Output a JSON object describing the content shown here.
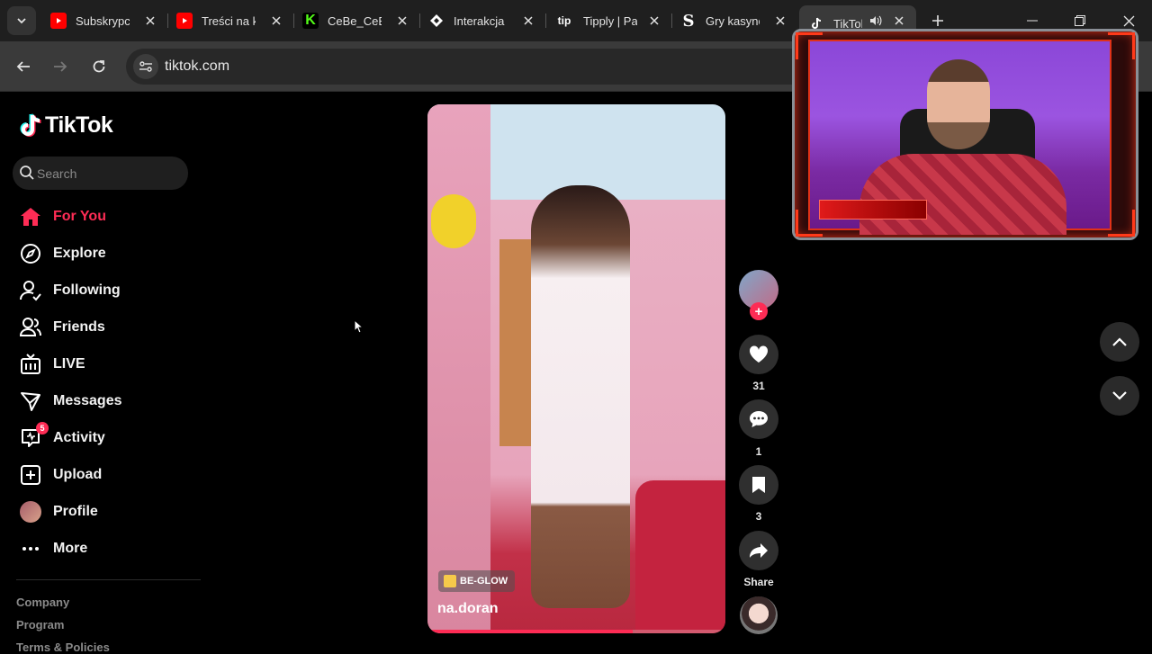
{
  "browser": {
    "tabs": [
      {
        "label": "Subskrypcje",
        "favicon": "youtube",
        "color": "#ff0000"
      },
      {
        "label": "Treści na kanale",
        "favicon": "youtube",
        "color": "#ff0000"
      },
      {
        "label": "CeBe_CeBe",
        "favicon": "kick",
        "color": "#53fc18"
      },
      {
        "label": "Interakcja",
        "favicon": "diamond",
        "color": "#ffffff"
      },
      {
        "label": "Tipply | Panel",
        "favicon": "tip",
        "color": "#ffffff"
      },
      {
        "label": "Gry kasynowe",
        "favicon": "s-logo",
        "color": "#ffffff"
      },
      {
        "label": "TikTok",
        "favicon": "tiktok",
        "color": "#ffffff"
      }
    ],
    "active_tab_index": 6,
    "url": "tiktok.com"
  },
  "tiktok": {
    "brand": "TikTok",
    "search_placeholder": "Search",
    "nav": [
      {
        "label": "For You",
        "icon": "home-icon",
        "active": true
      },
      {
        "label": "Explore",
        "icon": "compass-icon"
      },
      {
        "label": "Following",
        "icon": "following-icon"
      },
      {
        "label": "Friends",
        "icon": "friends-icon"
      },
      {
        "label": "LIVE",
        "icon": "live-icon"
      },
      {
        "label": "Messages",
        "icon": "messages-icon"
      },
      {
        "label": "Activity",
        "icon": "activity-icon",
        "badge": "5"
      },
      {
        "label": "Upload",
        "icon": "upload-icon"
      },
      {
        "label": "Profile",
        "icon": "avatar"
      },
      {
        "label": "More",
        "icon": "more-icon"
      }
    ],
    "footer": [
      "Company",
      "Program",
      "Terms & Policies"
    ],
    "video": {
      "tag": "BE-GLOW",
      "author": "na.doran",
      "progress": 0.69
    },
    "actions": {
      "likes": "31",
      "comments": "1",
      "saves": "3",
      "share": "Share"
    }
  },
  "colors": {
    "accent": "#fe2c55",
    "background": "#000000",
    "chrome": "#3a3a3a"
  }
}
